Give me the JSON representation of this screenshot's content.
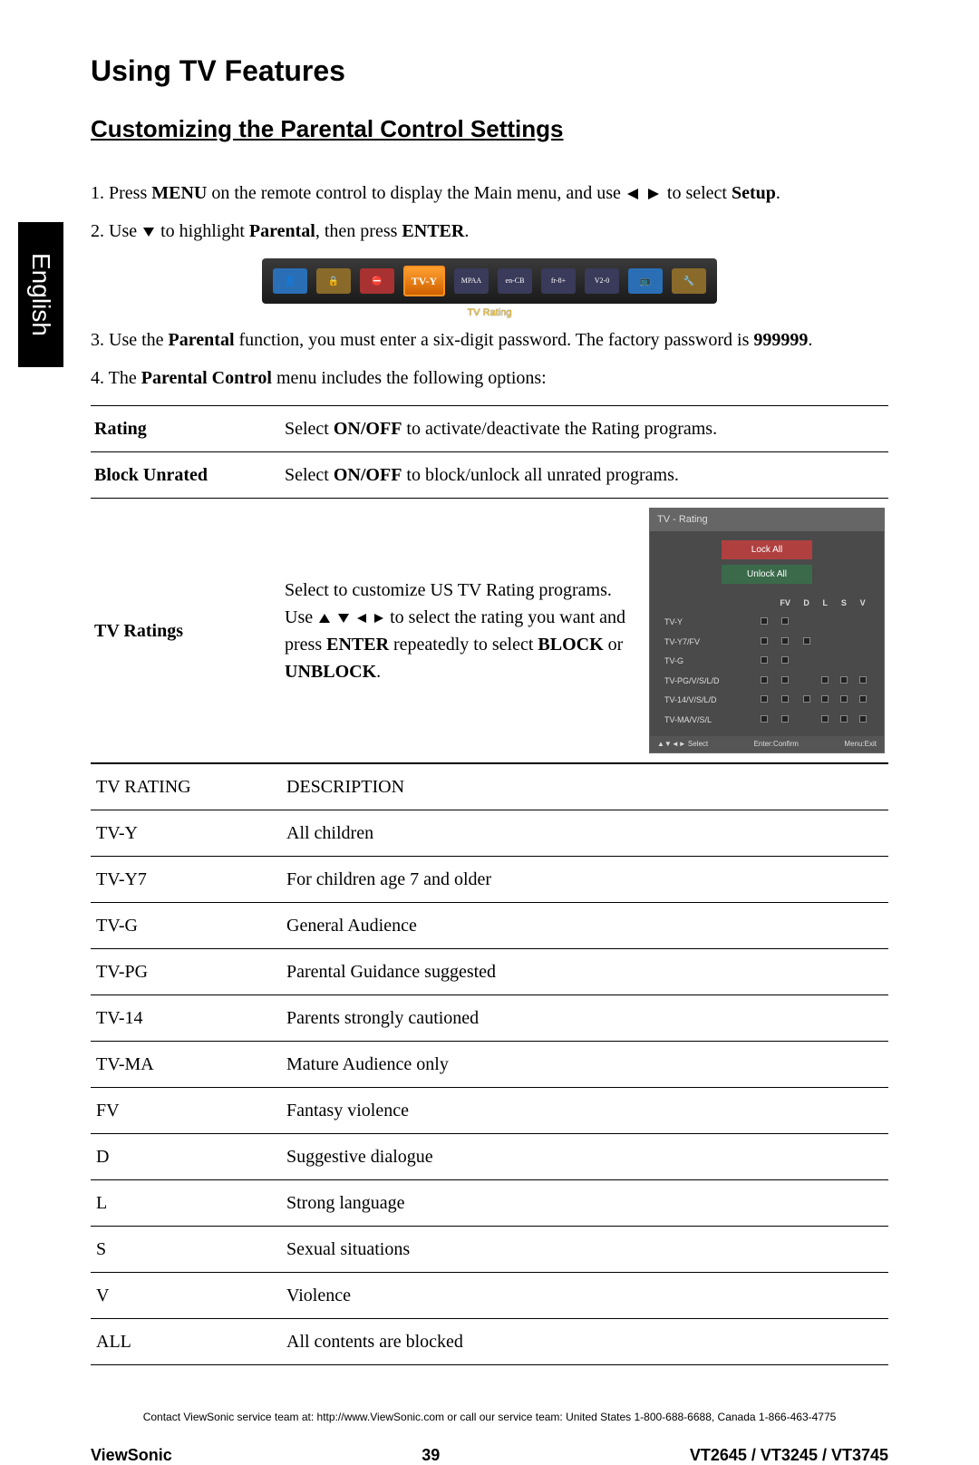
{
  "side_tab": "English",
  "h1": "Using TV Features",
  "h2": "Customizing the Parental Control Settings",
  "step1": {
    "prefix": "1. Press ",
    "bold1": "MENU",
    "mid": " on the remote control to display the Main menu, and use ",
    "suffix": " to select ",
    "bold2": "Setup",
    "period": "."
  },
  "step2": {
    "prefix": "2. Use ",
    "mid": " to highlight ",
    "bold1": "Parental",
    "mid2": ", then press ",
    "bold2": "ENTER",
    "period": "."
  },
  "menu_strip_label": "TV Rating",
  "step3": {
    "prefix": "3. Use the ",
    "bold1": "Parental",
    "mid": " function, you must enter a six-digit password. The factory password is ",
    "bold2": "999999",
    "period": "."
  },
  "step4": {
    "prefix": "4. The ",
    "bold1": "Parental Control",
    "suffix": " menu includes the following options:"
  },
  "options": {
    "rating": {
      "label": "Rating",
      "desc_pre": "Select ",
      "desc_bold": "ON/OFF",
      "desc_post": " to activate/deactivate the Rating programs."
    },
    "block_unrated": {
      "label": "Block Unrated",
      "desc_pre": "Select ",
      "desc_bold": "ON/OFF",
      "desc_post": " to block/unlock all unrated programs."
    },
    "tv_ratings": {
      "label": "TV Ratings",
      "p1": "Select to customize US TV Rating programs.",
      "p2_pre": "Use ",
      "p2_mid": " to select the rating you want and press ",
      "p2_bold1": "ENTER",
      "p2_mid2": " repeatedly to select ",
      "p2_bold2": "BLOCK",
      "p2_or": " or ",
      "p2_bold3": "UNBLOCK",
      "p2_period": "."
    }
  },
  "rating_panel": {
    "header": "TV - Rating",
    "lock": "Lock All",
    "unlock": "Unlock All",
    "cols": [
      "FV",
      "D",
      "L",
      "S",
      "V"
    ],
    "rows": [
      {
        "label": "TV-Y",
        "marks": [
          true,
          false,
          false,
          false,
          false
        ]
      },
      {
        "label": "TV-Y7/FV",
        "marks": [
          true,
          true,
          false,
          false,
          false
        ]
      },
      {
        "label": "TV-G",
        "marks": [
          true,
          false,
          false,
          false,
          false
        ]
      },
      {
        "label": "TV-PG/V/S/L/D",
        "marks": [
          true,
          false,
          true,
          true,
          true
        ]
      },
      {
        "label": "TV-14/V/S/L/D",
        "marks": [
          true,
          true,
          true,
          true,
          true
        ]
      },
      {
        "label": "TV-MA/V/S/L",
        "marks": [
          true,
          false,
          true,
          true,
          true
        ]
      }
    ],
    "footer_select": "▲▼◄► Select",
    "footer_confirm": "Enter:Confirm",
    "footer_exit": "Menu:Exit"
  },
  "ratings_table": {
    "header": [
      "TV RATING",
      "DESCRIPTION"
    ],
    "rows": [
      [
        "TV-Y",
        "All children"
      ],
      [
        "TV-Y7",
        "For children age 7 and older"
      ],
      [
        "TV-G",
        "General Audience"
      ],
      [
        "TV-PG",
        "Parental Guidance suggested"
      ],
      [
        "TV-14",
        "Parents strongly cautioned"
      ],
      [
        "TV-MA",
        "Mature Audience only"
      ],
      [
        "FV",
        "Fantasy violence"
      ],
      [
        "D",
        "Suggestive dialogue"
      ],
      [
        "L",
        "Strong language"
      ],
      [
        "S",
        "Sexual situations"
      ],
      [
        "V",
        "Violence"
      ],
      [
        "ALL",
        "All contents are blocked"
      ]
    ]
  },
  "footer_contact": "Contact ViewSonic service team at: http://www.ViewSonic.com or call our service team: United States 1-800-688-6688, Canada 1-866-463-4775",
  "footer": {
    "brand": "ViewSonic",
    "page": "39",
    "models": "VT2645 / VT3245 / VT3745"
  }
}
